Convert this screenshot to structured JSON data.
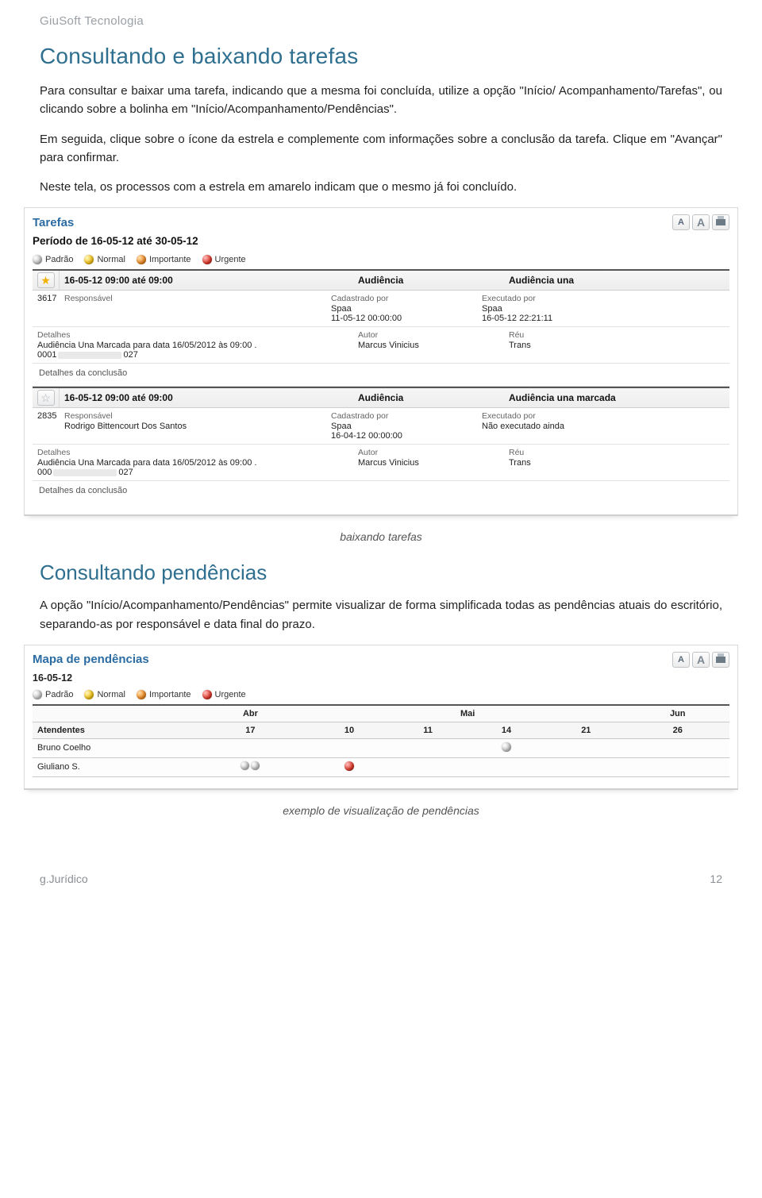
{
  "brand": "GiuSoft Tecnologia",
  "section1_title": "Consultando e baixando tarefas",
  "p1": "Para consultar e baixar uma tarefa, indicando que a mesma foi concluída, utilize a opção \"Início/ Acompanhamento/Tarefas\", ou clicando sobre a bolinha em \"Início/Acompanhamento/Pendências\".",
  "p2": "Em seguida, clique sobre o ícone da estrela e complemente com informações sobre a conclusão da tarefa. Clique em \"Avançar\" para confirmar.",
  "p3": "Neste tela, os processos com a estrela em amarelo indicam que o mesmo já foi concluído.",
  "caption1": "baixando tarefas",
  "section2_title": "Consultando pendências",
  "p4": "A opção \"Início/Acompanhamento/Pendências\" permite visualizar de forma simplificada todas as pendências atuais do escritório, separando-as por responsável e data final do prazo.",
  "caption2": "exemplo de visualização de pendências",
  "footer_left": "g.Jurídico",
  "footer_right": "12",
  "tarefas": {
    "title": "Tarefas",
    "period": "Período de 16-05-12 até 30-05-12",
    "legend": {
      "p": "Padrão",
      "n": "Normal",
      "i": "Importante",
      "u": "Urgente"
    },
    "cols": {
      "time_label": "16-05-12 09:00 até 09:00",
      "tipo": "Audiência"
    },
    "labels": {
      "resp": "Responsável",
      "cad": "Cadastrado por",
      "exec": "Executado por",
      "detalhes": "Detalhes",
      "autor": "Autor",
      "reu": "Réu",
      "conclusao": "Detalhes da conclusão"
    },
    "t1": {
      "desc": "Audiência una",
      "id": "3617",
      "resp": "",
      "cad_by": "Spaa",
      "cad_dt": "11-05-12 00:00:00",
      "exec_by": "Spaa",
      "exec_dt": "16-05-12 22:21:11",
      "detalhes_l1": "Audiência Una Marcada para data 16/05/2012 às 09:00 .",
      "detalhes_l2a": "0001",
      "detalhes_l2b": "027",
      "autor": "Marcus Vinicius",
      "reu": "Trans"
    },
    "t2": {
      "desc": "Audiência una marcada",
      "id": "2835",
      "resp": "Rodrigo Bittencourt Dos Santos",
      "cad_by": "Spaa",
      "cad_dt": "16-04-12 00:00:00",
      "exec_by": "Não executado ainda",
      "detalhes_l1": "Audiência Una Marcada para data 16/05/2012 às 09:00 .",
      "detalhes_l2a": "000",
      "detalhes_l2b": "027",
      "autor": "Marcus Vinicius",
      "reu": "Trans"
    }
  },
  "pend": {
    "title": "Mapa de pendências",
    "date": "16-05-12",
    "legend": {
      "p": "Padrão",
      "n": "Normal",
      "i": "Importante",
      "u": "Urgente"
    },
    "months": {
      "abr": "Abr",
      "mai": "Mai",
      "jun": "Jun"
    },
    "days": {
      "d17": "17",
      "d10": "10",
      "d11": "11",
      "d14": "14",
      "d21": "21",
      "d26": "26"
    },
    "col_atend": "Atendentes",
    "rows": {
      "r1": "Bruno Coelho",
      "r2": "Giuliano S."
    }
  }
}
